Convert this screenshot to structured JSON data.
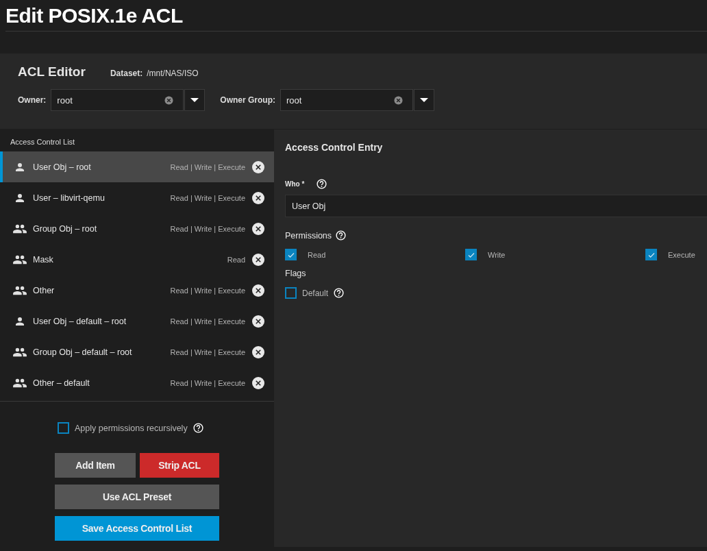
{
  "page_title": "Edit POSIX.1e ACL",
  "editor": {
    "title": "ACL Editor",
    "dataset_label": "Dataset:",
    "dataset_path": "/mnt/NAS/ISO",
    "owner": {
      "label": "Owner:",
      "value": "root"
    },
    "owner_group": {
      "label": "Owner Group:",
      "value": "root"
    }
  },
  "acl_list": {
    "title": "Access Control List",
    "entries": [
      {
        "kind": "user",
        "name": "User Obj – root",
        "permissions": "Read | Write | Execute",
        "selected": true
      },
      {
        "kind": "user",
        "name": "User – libvirt-qemu",
        "permissions": "Read | Write | Execute",
        "selected": false
      },
      {
        "kind": "group",
        "name": "Group Obj – root",
        "permissions": "Read | Write | Execute",
        "selected": false
      },
      {
        "kind": "group",
        "name": "Mask",
        "permissions": "Read",
        "selected": false
      },
      {
        "kind": "group",
        "name": "Other",
        "permissions": "Read | Write | Execute",
        "selected": false
      },
      {
        "kind": "user",
        "name": "User Obj – default – root",
        "permissions": "Read | Write | Execute",
        "selected": false
      },
      {
        "kind": "group",
        "name": "Group Obj – default – root",
        "permissions": "Read | Write | Execute",
        "selected": false
      },
      {
        "kind": "group",
        "name": "Other – default",
        "permissions": "Read | Write | Execute",
        "selected": false
      }
    ]
  },
  "recursive": {
    "label": "Apply permissions recursively",
    "checked": false
  },
  "buttons": [
    {
      "kind": "neutral",
      "label": "Add Item"
    },
    {
      "kind": "danger",
      "label": "Strip ACL"
    },
    {
      "kind": "neutral",
      "label": "Use ACL Preset"
    },
    {
      "kind": "primary",
      "label": "Save Access Control List"
    }
  ],
  "entry": {
    "title": "Access Control Entry",
    "who_label": "Who *",
    "who_value": "User Obj",
    "permissions_label": "Permissions",
    "permissions": [
      {
        "label": "Read",
        "checked": true
      },
      {
        "label": "Write",
        "checked": true
      },
      {
        "label": "Execute",
        "checked": true
      }
    ],
    "flags_label": "Flags",
    "flags": [
      {
        "label": "Default",
        "checked": false
      }
    ]
  }
}
